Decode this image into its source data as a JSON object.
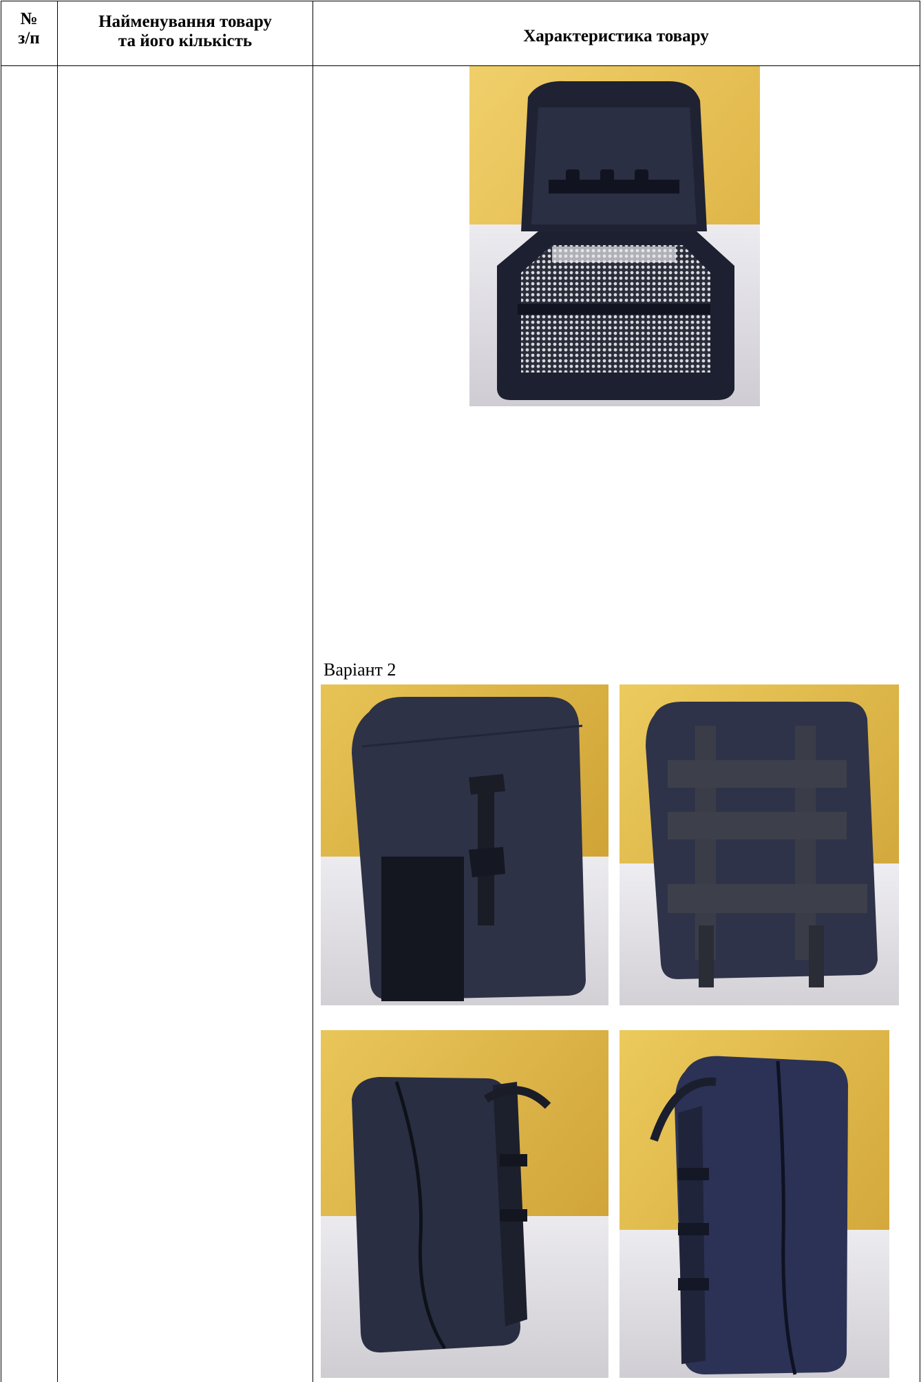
{
  "table": {
    "header": {
      "number_label": "№\nз/п",
      "name_label": "Найменування товару\nта його кількість",
      "characteristics_label": "Характеристика   товару"
    }
  },
  "content": {
    "variant_label": "Варіант 2",
    "photos": [
      {
        "icon": "pouch-open-interior-photo"
      },
      {
        "icon": "pouch-front-velcro-buckle-photo"
      },
      {
        "icon": "pouch-back-molle-photo"
      },
      {
        "icon": "pouch-side-zipper-left-photo"
      },
      {
        "icon": "pouch-side-zipper-right-photo"
      }
    ]
  },
  "colors": {
    "pouch_navy": "#24283c",
    "wall_yellow": "#e6bf4a",
    "cloth_white": "#e4e3e6"
  }
}
